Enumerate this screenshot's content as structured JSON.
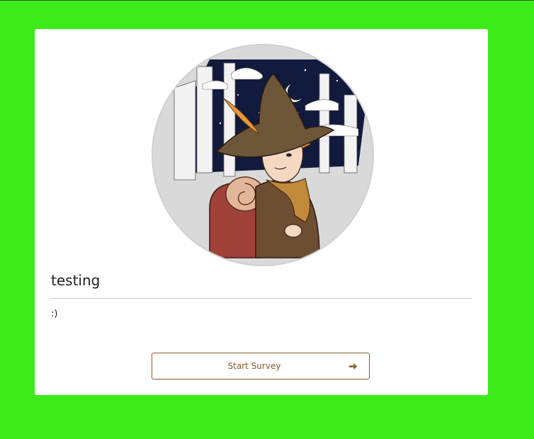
{
  "survey": {
    "title": "testing",
    "description": ":)",
    "start_label": "Start Survey",
    "start_icon": "arrow-right-icon",
    "cover_image": "character-illustration-with-hat-and-backpack"
  },
  "colors": {
    "background": "#3deb1a",
    "card": "#ffffff",
    "accent": "#8a5a2b"
  }
}
